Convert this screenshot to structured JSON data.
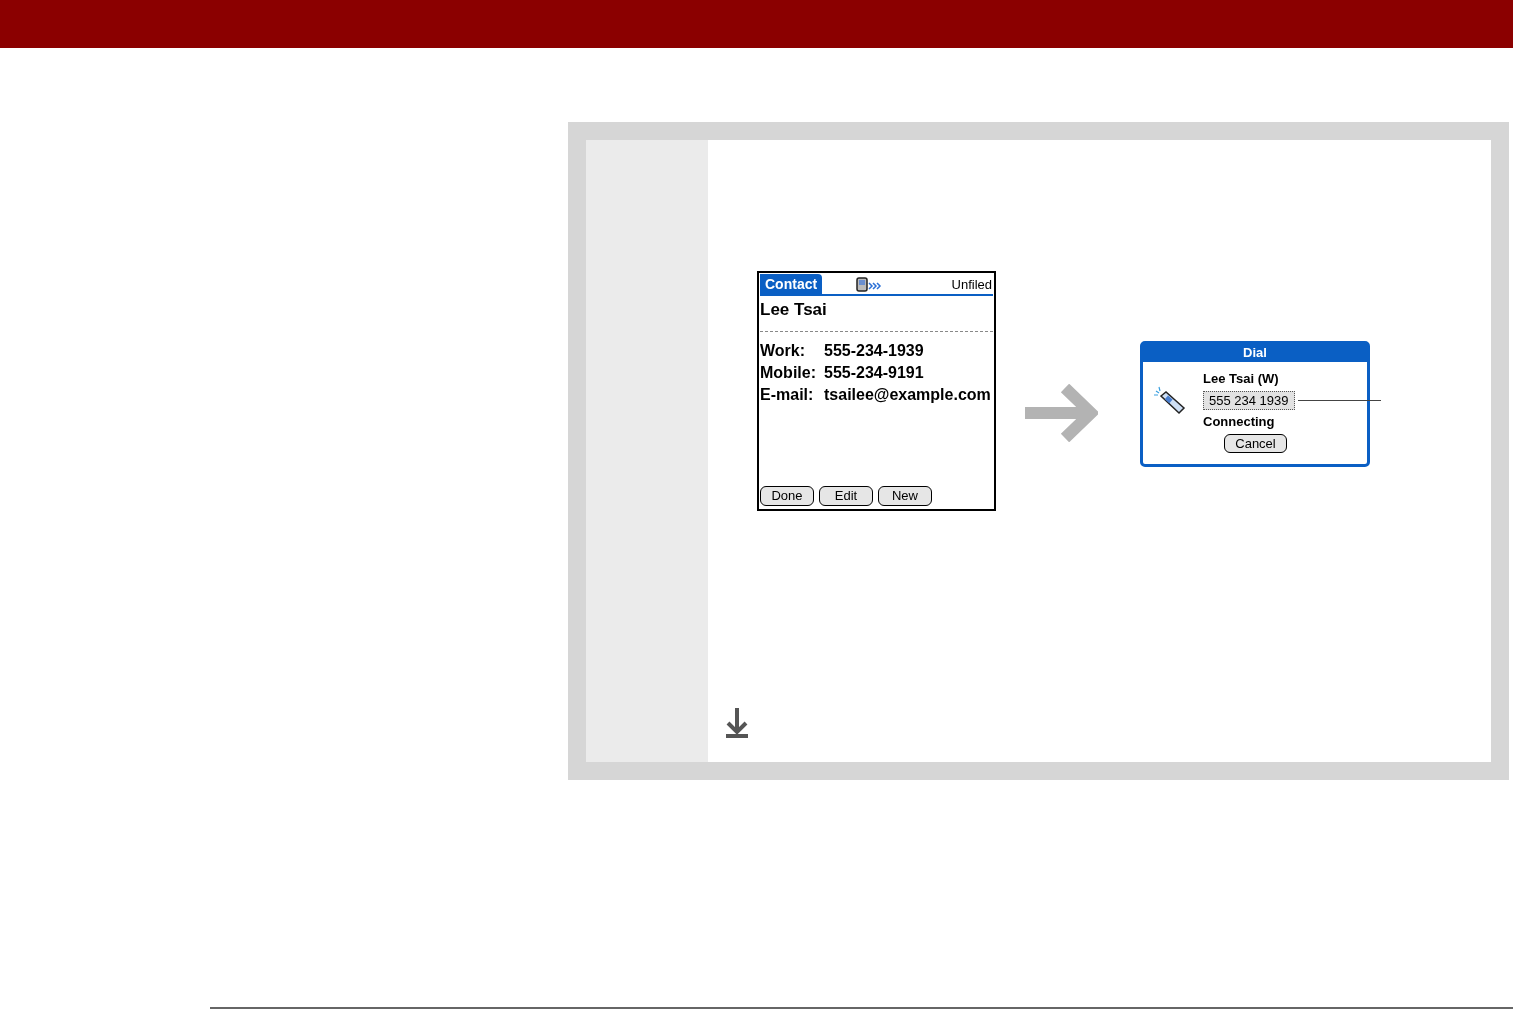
{
  "contact_screen": {
    "tab": "Contact",
    "category": "Unfiled",
    "name": "Lee Tsai",
    "fields": [
      {
        "label": "Work:",
        "value": "555-234-1939"
      },
      {
        "label": "Mobile:",
        "value": "555-234-9191"
      },
      {
        "label": "E-mail:",
        "value": "tsailee@example.com"
      }
    ],
    "buttons": [
      "Done",
      "Edit",
      "New"
    ]
  },
  "dial_dialog": {
    "title": "Dial",
    "name": "Lee Tsai (W)",
    "number": "555 234 1939",
    "status": "Connecting",
    "button": "Cancel"
  }
}
